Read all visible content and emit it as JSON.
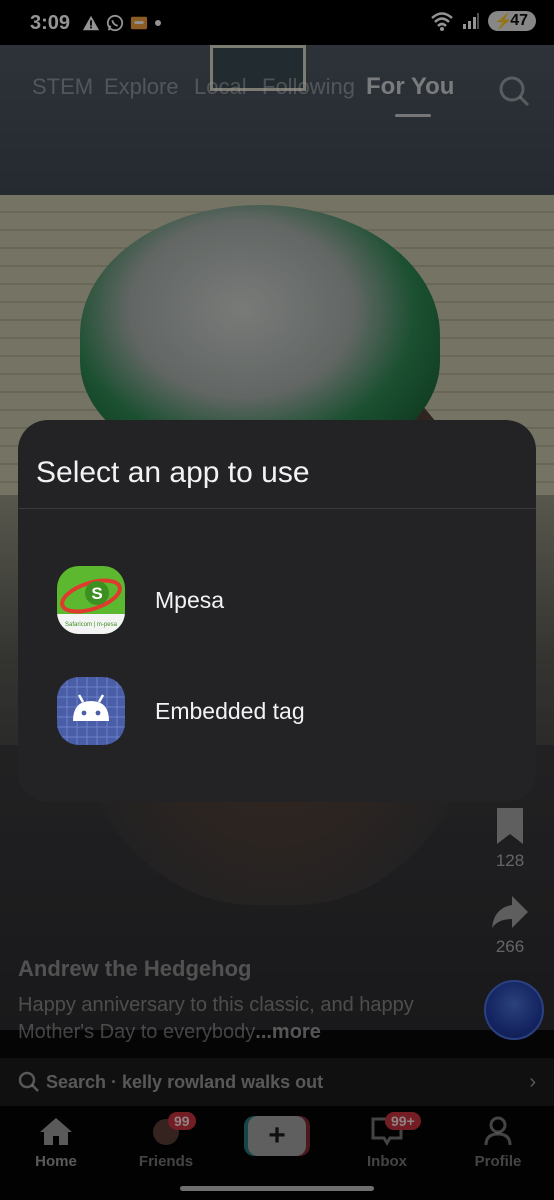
{
  "status_bar": {
    "time": "3:09",
    "battery_level": "47",
    "left_icons": [
      "warning-icon",
      "whatsapp-icon",
      "app-notification-icon",
      "dot-icon"
    ],
    "right_icons": [
      "wifi-icon",
      "signal-icon",
      "battery-icon"
    ]
  },
  "top_tabs": {
    "items": [
      "STEM",
      "Explore",
      "Local",
      "Following",
      "For You"
    ],
    "active": "For You"
  },
  "side_actions": {
    "bookmark_count": "128",
    "share_count": "266"
  },
  "video": {
    "author": "Andrew the Hedgehog",
    "caption": "Happy anniversary to this classic, and happy Mother's Day to everybody",
    "more_label": "...more"
  },
  "search_bar": {
    "text": "Search · kelly rowland walks out"
  },
  "bottom_nav": {
    "home": "Home",
    "friends": "Friends",
    "friends_badge": "99",
    "inbox": "Inbox",
    "inbox_badge": "99+",
    "profile": "Profile"
  },
  "dialog": {
    "title": "Select an app to use",
    "apps": [
      {
        "label": "Mpesa",
        "icon": "mpesa-app-icon",
        "icon_text": "Safaricom | m-pesa",
        "icon_letter": "S"
      },
      {
        "label": "Embedded tag",
        "icon": "android-app-icon"
      }
    ]
  },
  "colors": {
    "dialog_bg": "#232325",
    "mpesa_green": "#5cb82e",
    "mpesa_red": "#e03a2e",
    "android_icon_bg": "#4a5ea8",
    "badge_red": "#c8323e"
  }
}
